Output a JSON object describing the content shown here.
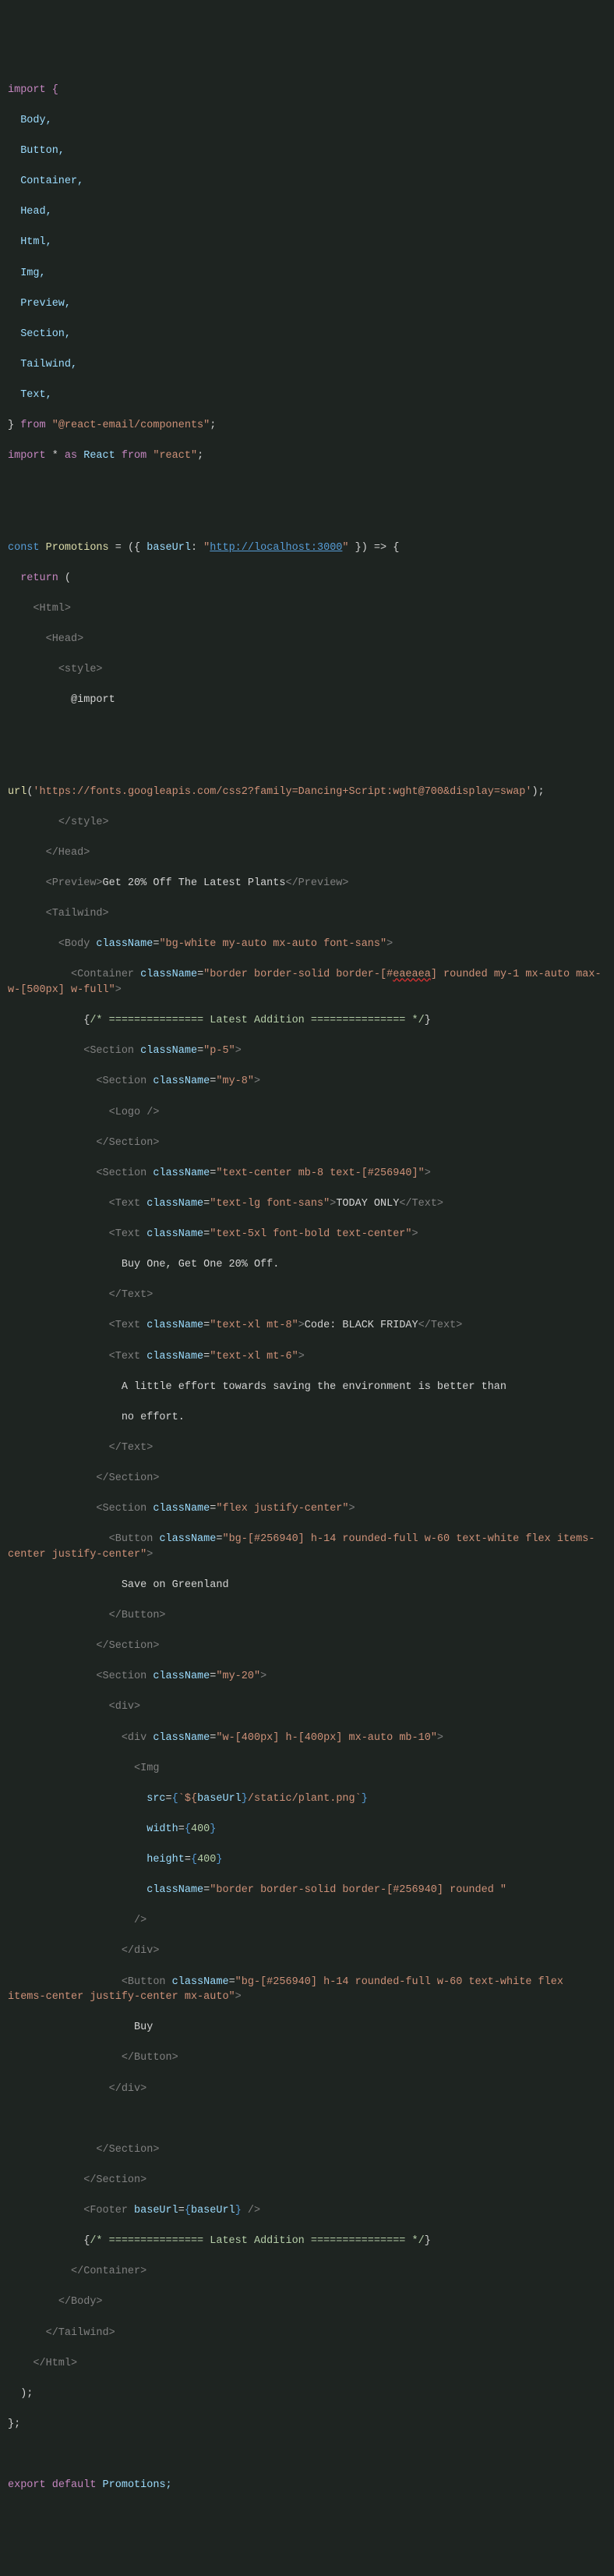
{
  "lines": {
    "l1": "import {",
    "l2": "  Body,",
    "l3": "  Button,",
    "l4": "  Container,",
    "l5": "  Head,",
    "l6": "  Html,",
    "l7": "  Img,",
    "l8": "  Preview,",
    "l9": "  Section,",
    "l10": "  Tailwind,",
    "l11": "  Text,",
    "l12_a": "} ",
    "l12_b": "from",
    "l12_c": " ",
    "l12_d": "\"@react-email/components\"",
    "l12_e": ";",
    "l13_a": "import",
    "l13_b": " * ",
    "l13_c": "as",
    "l13_d": " React ",
    "l13_e": "from",
    "l13_f": " ",
    "l13_g": "\"react\"",
    "l13_h": ";",
    "l16_a": "const",
    "l16_b": " ",
    "l16_c": "Promotions",
    "l16_d": " = ({ ",
    "l16_e": "baseUrl",
    "l16_f": ": ",
    "l16_g": "\"",
    "l16_h": "http://localhost:3000",
    "l16_i": "\"",
    "l16_j": " }) => {",
    "l17_a": "  ",
    "l17_b": "return",
    "l17_c": " (",
    "l18": "    <Html>",
    "l19": "      <Head>",
    "l20": "        <style>",
    "l21": "          @import",
    "l24_a": "url",
    "l24_b": "(",
    "l24_c": "'https://fonts.googleapis.com/css2?family=Dancing+Script:wght@700&display=swap'",
    "l24_d": ");",
    "l25": "        </style>",
    "l26": "      </Head>",
    "l27_a": "      <Preview>",
    "l27_b": "Get 20% Off The Latest Plants",
    "l27_c": "</Preview>",
    "l28": "      <Tailwind>",
    "l29_a": "        <Body ",
    "l29_b": "className",
    "l29_c": "=",
    "l29_d": "\"bg-white my-auto mx-auto font-sans\"",
    "l29_e": ">",
    "l30_a": "          <Container ",
    "l30_b": "className",
    "l30_c": "=",
    "l30_d": "\"border border-solid border-[#",
    "l30_e": "eaeaea",
    "l30_f": "] rounded my-1 mx-auto max-w-[500px] w-full\"",
    "l30_g": ">",
    "l31_a": "            {",
    "l31_b": "/* =============== Latest Addition =============== */",
    "l31_c": "}",
    "l32_a": "            <Section ",
    "l32_b": "className",
    "l32_c": "=",
    "l32_d": "\"p-5\"",
    "l32_e": ">",
    "l33_a": "              <Section ",
    "l33_b": "className",
    "l33_c": "=",
    "l33_d": "\"my-8\"",
    "l33_e": ">",
    "l34": "                <Logo />",
    "l35": "              </Section>",
    "l36_a": "              <Section ",
    "l36_b": "className",
    "l36_c": "=",
    "l36_d": "\"text-center mb-8 text-[#256940]\"",
    "l36_e": ">",
    "l37_a": "                <Text ",
    "l37_b": "className",
    "l37_c": "=",
    "l37_d": "\"text-lg font-sans\"",
    "l37_e": ">",
    "l37_f": "TODAY ONLY",
    "l37_g": "</Text>",
    "l38_a": "                <Text ",
    "l38_b": "className",
    "l38_c": "=",
    "l38_d": "\"text-5xl font-bold text-center\"",
    "l38_e": ">",
    "l39": "                  Buy One, Get One 20% Off.",
    "l40": "                </Text>",
    "l41_a": "                <Text ",
    "l41_b": "className",
    "l41_c": "=",
    "l41_d": "\"text-xl mt-8\"",
    "l41_e": ">",
    "l41_f": "Code: BLACK FRIDAY",
    "l41_g": "</Text>",
    "l42_a": "                <Text ",
    "l42_b": "className",
    "l42_c": "=",
    "l42_d": "\"text-xl mt-6\"",
    "l42_e": ">",
    "l43": "                  A little effort towards saving the environment is better than",
    "l44": "                  no effort.",
    "l45": "                </Text>",
    "l46": "              </Section>",
    "l47_a": "              <Section ",
    "l47_b": "className",
    "l47_c": "=",
    "l47_d": "\"flex justify-center\"",
    "l47_e": ">",
    "l48_a": "                <Button ",
    "l48_b": "className",
    "l48_c": "=",
    "l48_d": "\"bg-[#256940] h-14 rounded-full w-60 text-white flex items-center justify-center\"",
    "l48_e": ">",
    "l49": "                  Save on Greenland",
    "l50": "                </Button>",
    "l51": "              </Section>",
    "l52_a": "              <Section ",
    "l52_b": "className",
    "l52_c": "=",
    "l52_d": "\"my-20\"",
    "l52_e": ">",
    "l53": "                <div>",
    "l54_a": "                  <div ",
    "l54_b": "className",
    "l54_c": "=",
    "l54_d": "\"w-[400px] h-[400px] mx-auto mb-10\"",
    "l54_e": ">",
    "l55": "                    <Img",
    "l56_a": "                      ",
    "l56_b": "src",
    "l56_c": "=",
    "l56_d": "{",
    "l56_e": "`${",
    "l56_f": "baseUrl",
    "l56_g": "}",
    "l56_h": "/static/plant.png`",
    "l56_i": "}",
    "l57_a": "                      ",
    "l57_b": "width",
    "l57_c": "=",
    "l57_d": "{",
    "l57_e": "400",
    "l57_f": "}",
    "l58_a": "                      ",
    "l58_b": "height",
    "l58_c": "=",
    "l58_d": "{",
    "l58_e": "400",
    "l58_f": "}",
    "l59_a": "                      ",
    "l59_b": "className",
    "l59_c": "=",
    "l59_d": "\"border border-solid border-[#256940] rounded \"",
    "l60": "                    />",
    "l61": "                  </div>",
    "l62_a": "                  <Button ",
    "l62_b": "className",
    "l62_c": "=",
    "l62_d": "\"bg-[#256940] h-14 rounded-full w-60 text-white flex items-center justify-center mx-auto\"",
    "l62_e": ">",
    "l63": "                    Buy",
    "l64": "                  </Button>",
    "l65": "                </div>",
    "l67": "              </Section>",
    "l68": "            </Section>",
    "l69_a": "            <Footer ",
    "l69_b": "baseUrl",
    "l69_c": "=",
    "l69_d": "{",
    "l69_e": "baseUrl",
    "l69_f": "}",
    "l69_g": " />",
    "l70_a": "            {",
    "l70_b": "/* =============== Latest Addition =============== */",
    "l70_c": "}",
    "l71": "          </Container>",
    "l72": "        </Body>",
    "l73": "      </Tailwind>",
    "l74": "    </Html>",
    "l75": "  );",
    "l76": "};",
    "l78_a": "export",
    "l78_b": " ",
    "l78_c": "default",
    "l78_d": " Promotions;"
  }
}
